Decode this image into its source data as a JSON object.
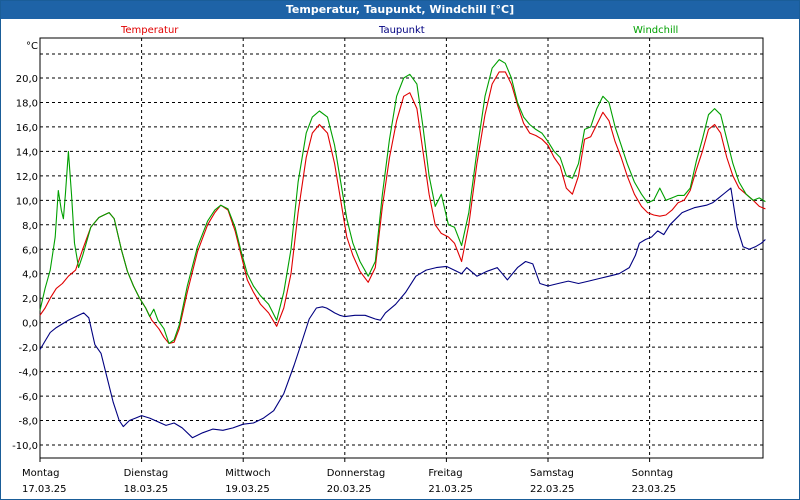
{
  "window": {
    "title": "Temperatur, Taupunkt, Windchill [°C]"
  },
  "chart_data": {
    "type": "line",
    "title": "Temperatur, Taupunkt, Windchill [°C]",
    "ylabel": "°C",
    "ylim": [
      -11,
      22
    ],
    "xlim": [
      0,
      7.15
    ],
    "grid": true,
    "legend_placement": "top",
    "y_ticks": [
      20,
      18,
      16,
      14,
      12,
      10,
      8,
      6,
      4,
      2,
      0,
      -2,
      -4,
      -6,
      -8,
      -10
    ],
    "y_tick_labels": [
      "20,0",
      "18,0",
      "16,0",
      "14,0",
      "12,0",
      "10,0",
      "8,0",
      "6,0",
      "4,0",
      "2,0",
      "0,0",
      "-2,0",
      "-4,0",
      "-6,0",
      "-8,0",
      "-10,0"
    ],
    "x_days": [
      {
        "day": "Montag",
        "date": "17.03.25"
      },
      {
        "day": "Dienstag",
        "date": "18.03.25"
      },
      {
        "day": "Mittwoch",
        "date": "19.03.25"
      },
      {
        "day": "Donnerstag",
        "date": "20.03.25"
      },
      {
        "day": "Freitag",
        "date": "21.03.25"
      },
      {
        "day": "Samstag",
        "date": "22.03.25"
      },
      {
        "day": "Sonntag",
        "date": "23.03.25"
      }
    ],
    "series": [
      {
        "name": "Temperatur",
        "color": "#e00000",
        "x": [
          0.0,
          0.05,
          0.1,
          0.16,
          0.22,
          0.28,
          0.35,
          0.42,
          0.5,
          0.58,
          0.63,
          0.68,
          0.73,
          0.8,
          0.86,
          0.92,
          0.98,
          1.04,
          1.1,
          1.17,
          1.22,
          1.27,
          1.32,
          1.37,
          1.45,
          1.55,
          1.65,
          1.72,
          1.78,
          1.85,
          1.92,
          1.98,
          2.04,
          2.1,
          2.17,
          2.25,
          2.33,
          2.4,
          2.47,
          2.54,
          2.62,
          2.68,
          2.75,
          2.83,
          2.9,
          2.96,
          3.02,
          3.08,
          3.15,
          3.23,
          3.3,
          3.37,
          3.44,
          3.51,
          3.58,
          3.64,
          3.71,
          3.77,
          3.83,
          3.89,
          3.95,
          4.02,
          4.08,
          4.15,
          4.22,
          4.3,
          4.38,
          4.45,
          4.52,
          4.58,
          4.64,
          4.7,
          4.76,
          4.82,
          4.88,
          4.94,
          5.0,
          5.06,
          5.12,
          5.18,
          5.24,
          5.3,
          5.36,
          5.42,
          5.48,
          5.54,
          5.6,
          5.66,
          5.72,
          5.78,
          5.85,
          5.92,
          5.98,
          6.04,
          6.1,
          6.16,
          6.22,
          6.28,
          6.34,
          6.4,
          6.46,
          6.52,
          6.58,
          6.64,
          6.7,
          6.76,
          6.82,
          6.88,
          6.95,
          7.02,
          7.08,
          7.14
        ],
        "y": [
          0.6,
          1.2,
          2.0,
          2.8,
          3.2,
          3.8,
          4.3,
          6.0,
          7.8,
          8.6,
          8.8,
          9.0,
          8.5,
          6.0,
          4.2,
          3.0,
          2.0,
          1.2,
          0.2,
          -0.5,
          -1.2,
          -1.7,
          -1.6,
          -0.5,
          2.5,
          5.8,
          8.0,
          9.0,
          9.6,
          9.2,
          7.5,
          5.5,
          3.5,
          2.5,
          1.5,
          0.8,
          -0.3,
          1.2,
          4.0,
          9.0,
          13.5,
          15.5,
          16.2,
          15.5,
          13.0,
          10.0,
          7.0,
          5.5,
          4.2,
          3.3,
          4.5,
          9.5,
          13.5,
          16.5,
          18.5,
          18.8,
          17.5,
          14.0,
          10.5,
          8.0,
          7.3,
          7.0,
          6.5,
          5.0,
          8.0,
          13.0,
          17.0,
          19.5,
          20.5,
          20.5,
          19.5,
          17.8,
          16.3,
          15.5,
          15.3,
          15.0,
          14.5,
          13.5,
          12.8,
          11.0,
          10.5,
          12.0,
          15.0,
          15.2,
          16.2,
          17.2,
          16.5,
          14.8,
          13.5,
          12.0,
          10.5,
          9.5,
          9.0,
          8.8,
          8.7,
          8.8,
          9.2,
          9.8,
          10.0,
          10.8,
          12.5,
          14.0,
          15.8,
          16.2,
          15.5,
          13.5,
          12.0,
          11.0,
          10.5,
          10.0,
          9.5,
          9.3
        ]
      },
      {
        "name": "Taupunkt",
        "color": "#000080",
        "x": [
          0.0,
          0.05,
          0.1,
          0.16,
          0.22,
          0.28,
          0.33,
          0.38,
          0.43,
          0.48,
          0.54,
          0.6,
          0.66,
          0.72,
          0.78,
          0.82,
          0.88,
          0.94,
          1.0,
          1.08,
          1.16,
          1.24,
          1.32,
          1.4,
          1.5,
          1.6,
          1.7,
          1.8,
          1.9,
          2.0,
          2.1,
          2.2,
          2.3,
          2.4,
          2.5,
          2.58,
          2.65,
          2.72,
          2.78,
          2.82,
          2.86,
          2.9,
          2.95,
          3.0,
          3.1,
          3.2,
          3.3,
          3.35,
          3.4,
          3.5,
          3.6,
          3.7,
          3.8,
          3.9,
          4.0,
          4.1,
          4.15,
          4.2,
          4.3,
          4.4,
          4.5,
          4.55,
          4.6,
          4.7,
          4.78,
          4.85,
          4.92,
          5.0,
          5.1,
          5.2,
          5.3,
          5.4,
          5.5,
          5.6,
          5.7,
          5.8,
          5.86,
          5.9,
          5.96,
          6.02,
          6.08,
          6.14,
          6.2,
          6.26,
          6.32,
          6.38,
          6.44,
          6.5,
          6.56,
          6.62,
          6.68,
          6.74,
          6.8,
          6.86,
          6.92,
          6.98,
          7.04,
          7.1,
          7.14
        ],
        "y": [
          -2.2,
          -1.5,
          -0.8,
          -0.4,
          -0.1,
          0.2,
          0.4,
          0.6,
          0.8,
          0.4,
          -1.8,
          -2.5,
          -4.5,
          -6.5,
          -8.0,
          -8.5,
          -8.0,
          -7.8,
          -7.6,
          -7.8,
          -8.1,
          -8.4,
          -8.2,
          -8.6,
          -9.4,
          -9.0,
          -8.7,
          -8.8,
          -8.6,
          -8.3,
          -8.2,
          -7.8,
          -7.2,
          -5.8,
          -3.5,
          -1.5,
          0.3,
          1.2,
          1.3,
          1.2,
          1.0,
          0.8,
          0.6,
          0.5,
          0.6,
          0.6,
          0.3,
          0.2,
          0.8,
          1.5,
          2.5,
          3.8,
          4.3,
          4.5,
          4.6,
          4.2,
          4.0,
          4.5,
          3.8,
          4.2,
          4.5,
          4.0,
          3.5,
          4.5,
          5.0,
          4.8,
          3.2,
          3.0,
          3.2,
          3.4,
          3.2,
          3.4,
          3.6,
          3.8,
          4.0,
          4.5,
          5.5,
          6.5,
          6.8,
          7.0,
          7.5,
          7.2,
          8.0,
          8.5,
          9.0,
          9.2,
          9.4,
          9.5,
          9.6,
          9.8,
          10.2,
          10.6,
          11.0,
          7.8,
          6.2,
          6.0,
          6.2,
          6.5,
          6.8
        ]
      },
      {
        "name": "Windchill",
        "color": "#00a000",
        "x": [
          0.0,
          0.05,
          0.1,
          0.15,
          0.18,
          0.21,
          0.23,
          0.25,
          0.28,
          0.31,
          0.34,
          0.38,
          0.42,
          0.5,
          0.58,
          0.63,
          0.68,
          0.73,
          0.8,
          0.86,
          0.92,
          0.98,
          1.04,
          1.08,
          1.12,
          1.16,
          1.22,
          1.27,
          1.32,
          1.37,
          1.45,
          1.55,
          1.65,
          1.72,
          1.78,
          1.85,
          1.92,
          1.98,
          2.04,
          2.1,
          2.17,
          2.25,
          2.33,
          2.4,
          2.47,
          2.54,
          2.62,
          2.68,
          2.75,
          2.83,
          2.9,
          2.96,
          3.02,
          3.08,
          3.15,
          3.23,
          3.3,
          3.37,
          3.44,
          3.51,
          3.58,
          3.64,
          3.71,
          3.77,
          3.83,
          3.89,
          3.95,
          4.02,
          4.08,
          4.15,
          4.22,
          4.3,
          4.38,
          4.45,
          4.52,
          4.58,
          4.64,
          4.7,
          4.76,
          4.82,
          4.88,
          4.94,
          5.0,
          5.06,
          5.12,
          5.18,
          5.24,
          5.3,
          5.36,
          5.42,
          5.48,
          5.54,
          5.6,
          5.66,
          5.72,
          5.78,
          5.85,
          5.92,
          5.98,
          6.04,
          6.1,
          6.16,
          6.22,
          6.28,
          6.34,
          6.4,
          6.46,
          6.52,
          6.58,
          6.64,
          6.7,
          6.76,
          6.82,
          6.88,
          6.95,
          7.02,
          7.08,
          7.14
        ],
        "y": [
          1.0,
          2.8,
          4.3,
          7.0,
          10.8,
          9.2,
          8.5,
          10.5,
          14.0,
          10.5,
          6.5,
          4.5,
          5.5,
          7.8,
          8.6,
          8.8,
          9.0,
          8.5,
          6.0,
          4.2,
          3.0,
          2.0,
          1.2,
          0.5,
          1.1,
          0.2,
          -0.5,
          -1.7,
          -1.4,
          -0.2,
          3.0,
          6.2,
          8.3,
          9.2,
          9.6,
          9.3,
          7.8,
          5.8,
          4.0,
          3.0,
          2.2,
          1.5,
          0.2,
          2.5,
          6.0,
          11.5,
          15.5,
          16.8,
          17.3,
          16.8,
          14.5,
          11.5,
          8.5,
          6.5,
          5.0,
          3.8,
          5.0,
          10.5,
          15.0,
          18.5,
          20.0,
          20.3,
          19.5,
          16.0,
          12.0,
          9.5,
          10.5,
          8.0,
          7.8,
          6.3,
          9.0,
          14.0,
          18.5,
          20.8,
          21.5,
          21.2,
          20.0,
          18.0,
          16.8,
          16.2,
          15.8,
          15.5,
          14.8,
          14.0,
          13.5,
          12.0,
          11.8,
          13.0,
          15.8,
          16.0,
          17.5,
          18.5,
          18.0,
          16.0,
          14.5,
          13.0,
          11.5,
          10.5,
          9.8,
          10.0,
          11.0,
          10.0,
          10.2,
          10.4,
          10.4,
          11.0,
          13.2,
          15.0,
          17.0,
          17.5,
          17.0,
          15.0,
          13.0,
          11.5,
          10.5,
          10.0,
          10.2,
          9.9
        ]
      }
    ]
  }
}
